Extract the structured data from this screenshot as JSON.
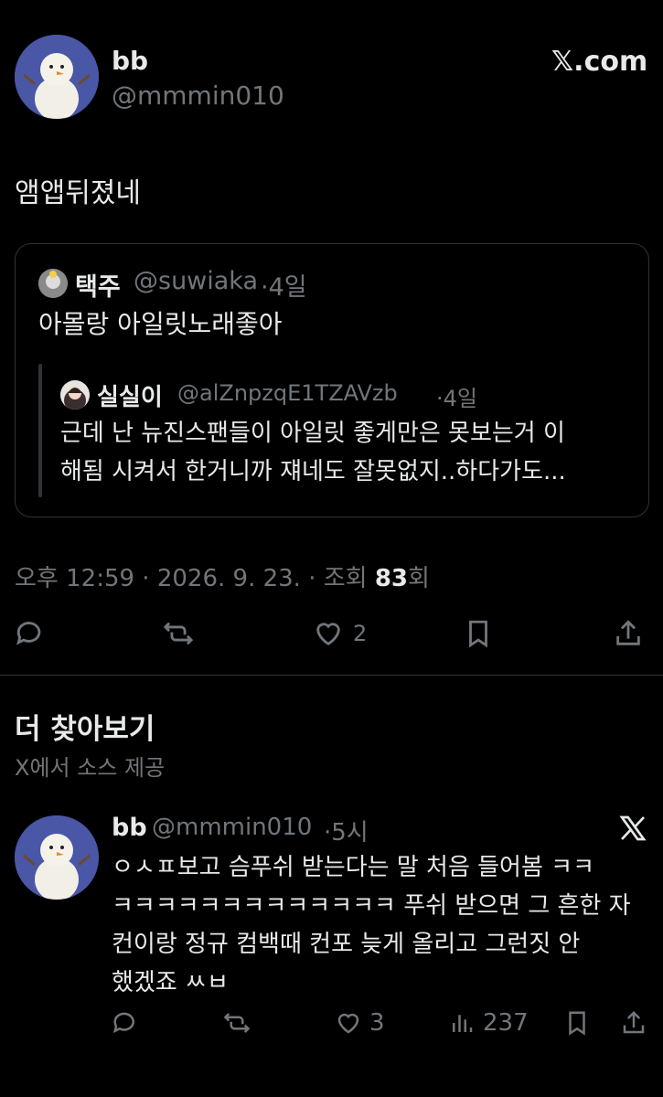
{
  "tweet": {
    "display_name": "bb",
    "handle": "@mmmin010",
    "brand": "𝕏.com",
    "text": "앰앱뒤졌네",
    "timestamp": "오후 12:59 · 2026. 9. 23. · 조회",
    "views": "83",
    "views_suffix": "회",
    "likes": "2"
  },
  "quote": {
    "display_name": "택주",
    "handle": "@suwiaka",
    "age": "·4일",
    "text": "아몰랑 아일릿노래좋아",
    "nested": {
      "display_name": "실실이",
      "handle": "@alZnpzqE1TZAVzb",
      "age": "·4일",
      "line1": "근데 난 뉴진스팬들이 아일릿 좋게만은 못보는거 이",
      "line2": "해됨 시켜서 한거니까 쟤네도 잘못없지..하다가도..."
    }
  },
  "discover": {
    "title": "더 찾아보기",
    "subtitle": "X에서 소스 제공"
  },
  "related": {
    "display_name": "bb",
    "handle": "@mmmin010",
    "age": "·5시",
    "line1": "ㅇㅅㅍ보고 슴푸쉬 받는다는 말 처음 들어봄 ㅋㅋ",
    "line2": "ㅋㅋㅋㅋㅋㅋㅋㅋㅋㅋㅋㅋㅋ 푸쉬 받으면 그 흔한 자",
    "line3": "컨이랑 정규 컴백때 컨포 늦게 올리고 그런짓 안",
    "line4": "했겠죠 ㅆㅂ",
    "likes": "3",
    "views": "237"
  },
  "icons": {
    "reply": "reply-icon",
    "retweet": "retweet-icon",
    "like": "heart-icon",
    "bookmark": "bookmark-icon",
    "share": "share-icon",
    "analytics": "analytics-icon",
    "x_logo": "x-logo-icon"
  },
  "colors": {
    "background": "#000000",
    "text": "#e7e9ea",
    "secondary": "#71767b",
    "border": "#2f3336"
  }
}
